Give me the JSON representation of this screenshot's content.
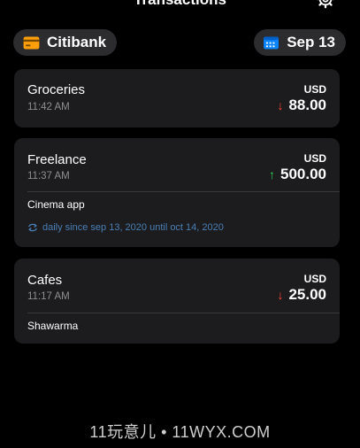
{
  "header": {
    "title": "Transactions",
    "settings_icon": "gear-icon"
  },
  "filters": {
    "account": {
      "label": "Citibank",
      "icon": "credit-card-icon",
      "icon_color": "#ff9f0a"
    },
    "date": {
      "label": "Sep 13",
      "icon": "calendar-icon",
      "icon_color": "#0a84ff"
    }
  },
  "transactions": [
    {
      "title": "Groceries",
      "time": "11:42 AM",
      "currency": "USD",
      "direction": "down",
      "amount": "88.00"
    },
    {
      "title": "Freelance",
      "time": "11:37 AM",
      "currency": "USD",
      "direction": "up",
      "amount": "500.00",
      "note": "Cinema app",
      "recurrence": "daily since sep 13, 2020 until oct 14, 2020"
    },
    {
      "title": "Cafes",
      "time": "11:17 AM",
      "currency": "USD",
      "direction": "down",
      "amount": "25.00",
      "note": "Shawarma"
    }
  ],
  "colors": {
    "background": "#000000",
    "card": "#1c1c1e",
    "pill": "#2c2c2e",
    "expense_arrow": "#ff453a",
    "income_arrow": "#30d158",
    "recurrence": "#4a7fb5"
  },
  "watermark": "11玩意儿 • 11WYX.COM"
}
